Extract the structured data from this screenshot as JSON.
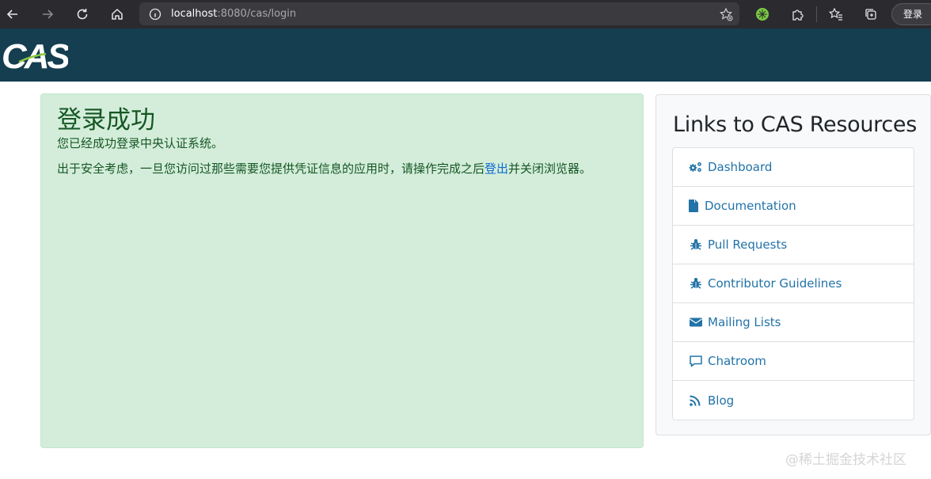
{
  "browser": {
    "url_host": "localhost",
    "url_rest": ":8080/cas/login",
    "login_label": "登录"
  },
  "header": {
    "logo_text": "CAS"
  },
  "success": {
    "title": "登录成功",
    "line1": "您已经成功登录中央认证系统。",
    "line2_before": "出于安全考虑，一旦您访问过那些需要您提供凭证信息的应用时，请操作完成之后",
    "line2_link": "登出",
    "line2_after": "并关闭浏览器。"
  },
  "sidebar": {
    "title": "Links to CAS Resources",
    "items": [
      {
        "label": "Dashboard",
        "icon": "gears-icon"
      },
      {
        "label": "Documentation",
        "icon": "file-icon"
      },
      {
        "label": "Pull Requests",
        "icon": "bug-icon"
      },
      {
        "label": "Contributor Guidelines",
        "icon": "bug-icon"
      },
      {
        "label": "Mailing Lists",
        "icon": "envelope-icon"
      },
      {
        "label": "Chatroom",
        "icon": "comment-icon"
      },
      {
        "label": "Blog",
        "icon": "rss-icon"
      }
    ]
  },
  "watermark": "@稀土掘金技术社区",
  "colors": {
    "header_bg": "#153e50",
    "success_bg": "#d4edda",
    "link": "#2273a8"
  }
}
